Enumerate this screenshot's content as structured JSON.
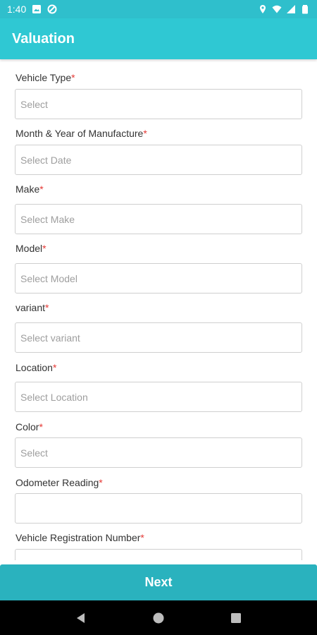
{
  "status_bar": {
    "time": "1:40",
    "icons_left": [
      "image-notification-icon",
      "data-saver-icon"
    ],
    "icons_right": [
      "location-icon",
      "wifi-icon",
      "signal-icon",
      "battery-icon"
    ]
  },
  "app_bar": {
    "title": "Valuation",
    "color": "#2fc8d3"
  },
  "form": {
    "required_marker": "*",
    "fields": [
      {
        "label": "Vehicle Type",
        "placeholder": "Select",
        "value": ""
      },
      {
        "label": "Month & Year of Manufacture",
        "placeholder": "Select Date",
        "value": ""
      },
      {
        "label": "Make",
        "placeholder": "Select Make",
        "value": ""
      },
      {
        "label": "Model",
        "placeholder": "Select Model",
        "value": ""
      },
      {
        "label": "variant",
        "placeholder": "Select variant",
        "value": ""
      },
      {
        "label": "Location",
        "placeholder": "Select Location",
        "value": ""
      },
      {
        "label": "Color",
        "placeholder": "Select",
        "value": ""
      },
      {
        "label": "Odometer Reading",
        "placeholder": "",
        "value": ""
      },
      {
        "label": "Vehicle Registration Number",
        "placeholder": "",
        "value": ""
      }
    ]
  },
  "footer": {
    "next_label": "Next",
    "button_color": "#2ab2be"
  },
  "nav_bar": {
    "buttons": [
      "back-icon",
      "home-icon",
      "recents-icon"
    ]
  }
}
